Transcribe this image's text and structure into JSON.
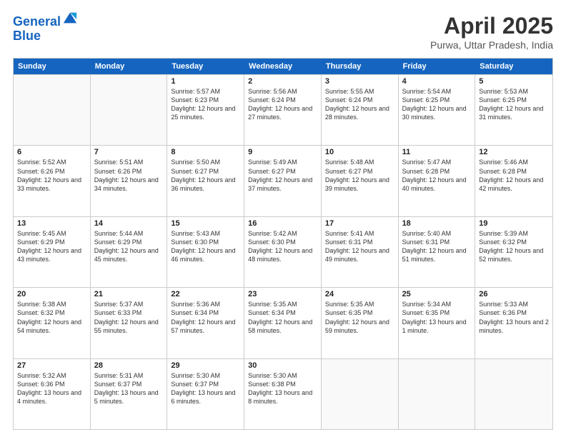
{
  "header": {
    "logo_line1": "General",
    "logo_line2": "Blue",
    "title": "April 2025",
    "subtitle": "Purwa, Uttar Pradesh, India"
  },
  "days_of_week": [
    "Sunday",
    "Monday",
    "Tuesday",
    "Wednesday",
    "Thursday",
    "Friday",
    "Saturday"
  ],
  "weeks": [
    [
      {
        "day": "",
        "empty": true
      },
      {
        "day": "",
        "empty": true
      },
      {
        "day": "1",
        "sunrise": "5:57 AM",
        "sunset": "6:23 PM",
        "daylight": "12 hours and 25 minutes."
      },
      {
        "day": "2",
        "sunrise": "5:56 AM",
        "sunset": "6:24 PM",
        "daylight": "12 hours and 27 minutes."
      },
      {
        "day": "3",
        "sunrise": "5:55 AM",
        "sunset": "6:24 PM",
        "daylight": "12 hours and 28 minutes."
      },
      {
        "day": "4",
        "sunrise": "5:54 AM",
        "sunset": "6:25 PM",
        "daylight": "12 hours and 30 minutes."
      },
      {
        "day": "5",
        "sunrise": "5:53 AM",
        "sunset": "6:25 PM",
        "daylight": "12 hours and 31 minutes."
      }
    ],
    [
      {
        "day": "6",
        "sunrise": "5:52 AM",
        "sunset": "6:26 PM",
        "daylight": "12 hours and 33 minutes."
      },
      {
        "day": "7",
        "sunrise": "5:51 AM",
        "sunset": "6:26 PM",
        "daylight": "12 hours and 34 minutes."
      },
      {
        "day": "8",
        "sunrise": "5:50 AM",
        "sunset": "6:27 PM",
        "daylight": "12 hours and 36 minutes."
      },
      {
        "day": "9",
        "sunrise": "5:49 AM",
        "sunset": "6:27 PM",
        "daylight": "12 hours and 37 minutes."
      },
      {
        "day": "10",
        "sunrise": "5:48 AM",
        "sunset": "6:27 PM",
        "daylight": "12 hours and 39 minutes."
      },
      {
        "day": "11",
        "sunrise": "5:47 AM",
        "sunset": "6:28 PM",
        "daylight": "12 hours and 40 minutes."
      },
      {
        "day": "12",
        "sunrise": "5:46 AM",
        "sunset": "6:28 PM",
        "daylight": "12 hours and 42 minutes."
      }
    ],
    [
      {
        "day": "13",
        "sunrise": "5:45 AM",
        "sunset": "6:29 PM",
        "daylight": "12 hours and 43 minutes."
      },
      {
        "day": "14",
        "sunrise": "5:44 AM",
        "sunset": "6:29 PM",
        "daylight": "12 hours and 45 minutes."
      },
      {
        "day": "15",
        "sunrise": "5:43 AM",
        "sunset": "6:30 PM",
        "daylight": "12 hours and 46 minutes."
      },
      {
        "day": "16",
        "sunrise": "5:42 AM",
        "sunset": "6:30 PM",
        "daylight": "12 hours and 48 minutes."
      },
      {
        "day": "17",
        "sunrise": "5:41 AM",
        "sunset": "6:31 PM",
        "daylight": "12 hours and 49 minutes."
      },
      {
        "day": "18",
        "sunrise": "5:40 AM",
        "sunset": "6:31 PM",
        "daylight": "12 hours and 51 minutes."
      },
      {
        "day": "19",
        "sunrise": "5:39 AM",
        "sunset": "6:32 PM",
        "daylight": "12 hours and 52 minutes."
      }
    ],
    [
      {
        "day": "20",
        "sunrise": "5:38 AM",
        "sunset": "6:32 PM",
        "daylight": "12 hours and 54 minutes."
      },
      {
        "day": "21",
        "sunrise": "5:37 AM",
        "sunset": "6:33 PM",
        "daylight": "12 hours and 55 minutes."
      },
      {
        "day": "22",
        "sunrise": "5:36 AM",
        "sunset": "6:34 PM",
        "daylight": "12 hours and 57 minutes."
      },
      {
        "day": "23",
        "sunrise": "5:35 AM",
        "sunset": "6:34 PM",
        "daylight": "12 hours and 58 minutes."
      },
      {
        "day": "24",
        "sunrise": "5:35 AM",
        "sunset": "6:35 PM",
        "daylight": "12 hours and 59 minutes."
      },
      {
        "day": "25",
        "sunrise": "5:34 AM",
        "sunset": "6:35 PM",
        "daylight": "13 hours and 1 minute."
      },
      {
        "day": "26",
        "sunrise": "5:33 AM",
        "sunset": "6:36 PM",
        "daylight": "13 hours and 2 minutes."
      }
    ],
    [
      {
        "day": "27",
        "sunrise": "5:32 AM",
        "sunset": "6:36 PM",
        "daylight": "13 hours and 4 minutes."
      },
      {
        "day": "28",
        "sunrise": "5:31 AM",
        "sunset": "6:37 PM",
        "daylight": "13 hours and 5 minutes."
      },
      {
        "day": "29",
        "sunrise": "5:30 AM",
        "sunset": "6:37 PM",
        "daylight": "13 hours and 6 minutes."
      },
      {
        "day": "30",
        "sunrise": "5:30 AM",
        "sunset": "6:38 PM",
        "daylight": "13 hours and 8 minutes."
      },
      {
        "day": "",
        "empty": true
      },
      {
        "day": "",
        "empty": true
      },
      {
        "day": "",
        "empty": true
      }
    ]
  ]
}
